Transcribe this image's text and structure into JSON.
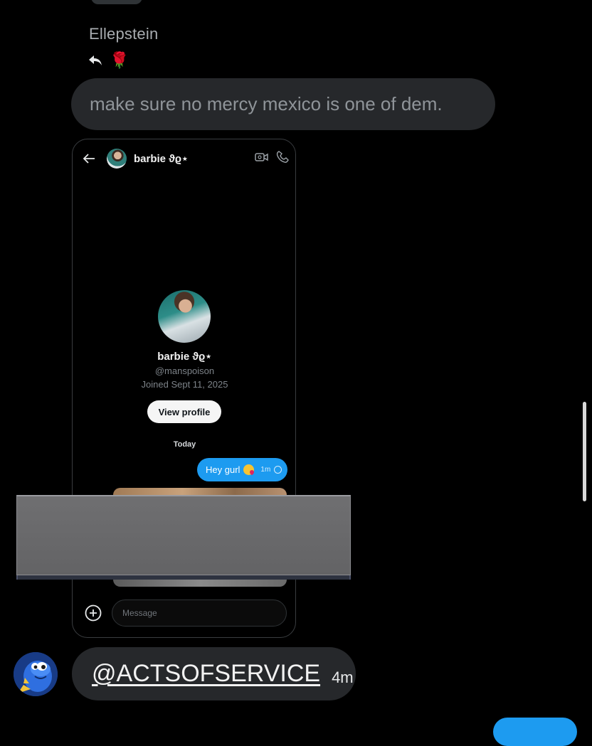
{
  "thread": {
    "sender_name": "Ellepstein",
    "reaction_emoji": "🌹",
    "message_text": "make sure no mercy mexico is one of dem."
  },
  "screenshot": {
    "header": {
      "contact_name": "barbie ϑϱ⋆"
    },
    "profile": {
      "name": "barbie ϑϱ⋆",
      "handle": "@manspoison",
      "joined": "Joined Sept 11, 2025",
      "view_profile_label": "View profile"
    },
    "day_label": "Today",
    "sent_message": {
      "text": "Hey gurl",
      "time": "1m"
    },
    "composer": {
      "placeholder": "Message"
    }
  },
  "last_message": {
    "mention": "@ACTSOFSERVICE",
    "time": "4m"
  },
  "colors": {
    "accent": "#1d9bf0",
    "bubble": "#26282b",
    "background": "#000000"
  }
}
